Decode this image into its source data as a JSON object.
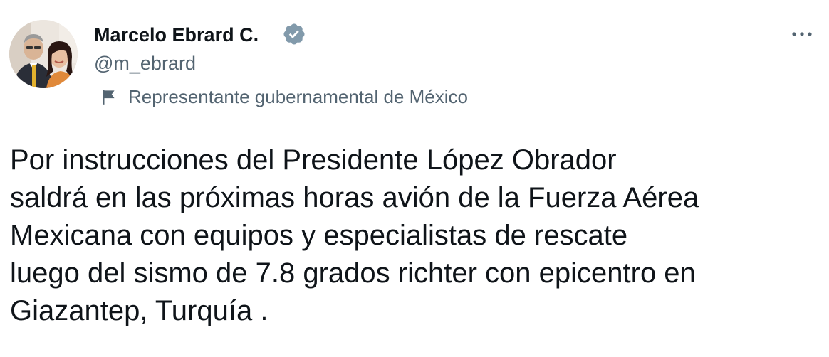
{
  "author": {
    "name": "Marcelo Ebrard C.",
    "handle": "@m_ebrard",
    "verified_badge_color": "#829aab"
  },
  "affiliation": {
    "icon": "flag-icon",
    "text": "Representante gubernamental de México"
  },
  "menu": {
    "icon": "more-icon"
  },
  "tweet": {
    "lines": [
      "Por instrucciones del Presidente López Obrador",
      "saldrá en las próximas horas avión de la Fuerza Aérea",
      "Mexicana con equipos y especialistas de rescate",
      "luego del sismo de 7.8 grados richter con epicentro en",
      "Giazantep, Turquía ."
    ]
  },
  "colors": {
    "text_primary": "#0f1419",
    "text_secondary": "#536471",
    "background": "#ffffff"
  }
}
